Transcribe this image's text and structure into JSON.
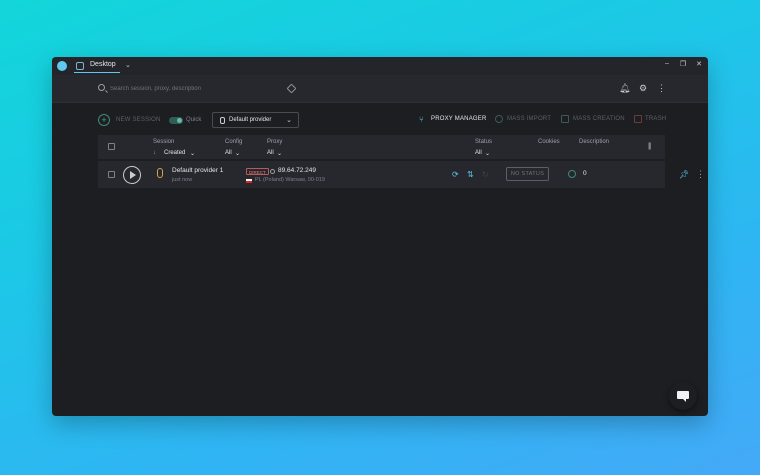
{
  "titlebar": {
    "app_icon": "app-logo-icon",
    "tab_label": "Desktop",
    "minimize": "–",
    "maximize": "❐",
    "close": "✕"
  },
  "header": {
    "search_placeholder": "Search session, proxy, description",
    "icons": [
      "bell-icon",
      "gear-icon",
      "more-vertical-icon"
    ]
  },
  "toolbar": {
    "new_session": "NEW SESSION",
    "quick": "Quick",
    "provider": "Default provider",
    "proxy_manager": "PROXY MANAGER",
    "mass_import": "MASS IMPORT",
    "mass_creation": "MASS CREATION",
    "trash": "TRASH",
    "colors": {
      "accent": "#5ec8f0",
      "disabled": "#5b6068",
      "toggle": "#2f5e57"
    }
  },
  "table": {
    "columns": {
      "session": "Session",
      "session_sort": "Created",
      "config": "Config",
      "config_filter": "All",
      "proxy": "Proxy",
      "proxy_filter": "All",
      "status": "Status",
      "status_filter": "All",
      "cookies": "Cookies",
      "description": "Description"
    },
    "rows": [
      {
        "name": "Default provider 1",
        "time": "just now",
        "proxy_type": "DIRECT",
        "ip": "89.64.72.249",
        "location": "PL (Poland) Warsaw, 00-019",
        "status": "NO STATUS",
        "cookies": "0"
      }
    ]
  }
}
